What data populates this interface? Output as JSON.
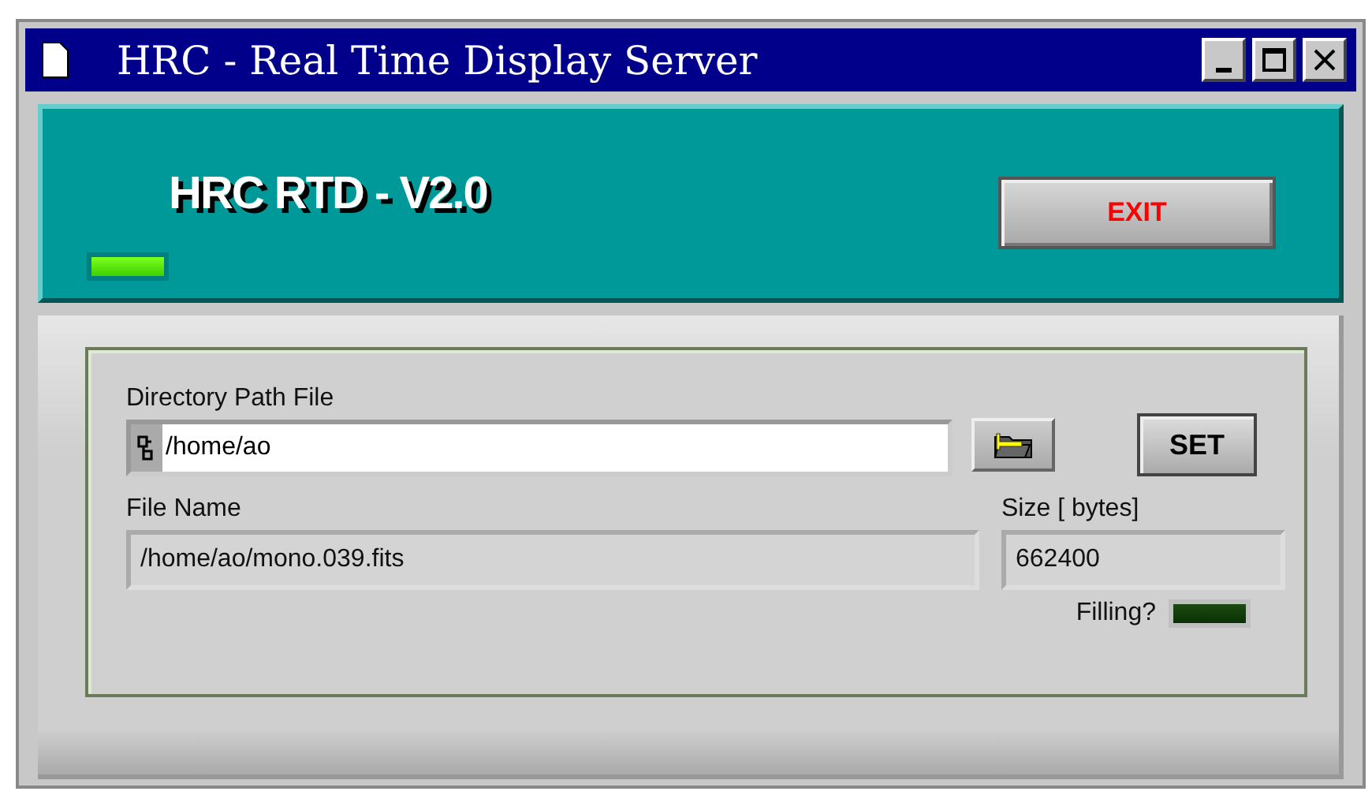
{
  "window": {
    "title": "HRC - Real Time Display Server"
  },
  "header": {
    "title": "HRC RTD - V2.0",
    "status_led": {
      "on": true
    },
    "exit_button": "EXIT"
  },
  "directory": {
    "label": "Directory Path File",
    "value": "/home/ao",
    "set_button": "SET"
  },
  "file_name": {
    "label": "File Name",
    "value": "/home/ao/mono.039.fits"
  },
  "size": {
    "label": "Size [ bytes]",
    "value": "662400"
  },
  "filling": {
    "label": "Filling?",
    "on": false
  }
}
